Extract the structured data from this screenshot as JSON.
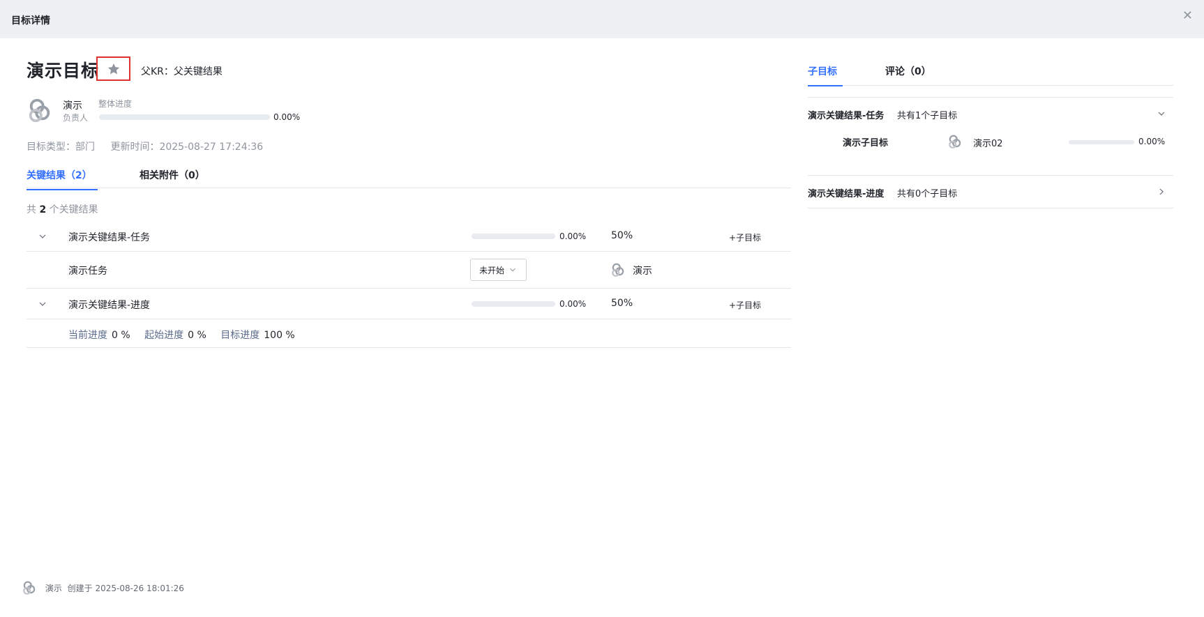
{
  "header": {
    "title": "目标详情",
    "close_icon": "close-icon"
  },
  "goal": {
    "title": "演示目标",
    "star_icon": "star-icon",
    "parent_kr": "父KR：父关键结果",
    "owner_name": "演示",
    "owner_role": "负责人",
    "overall_label": "整体进度",
    "overall_progress": 0.0,
    "overall_pct": "0.00%",
    "type_text": "目标类型：部门",
    "updated_text": "更新时间：2025-08-27 17:24:36"
  },
  "left_tabs": [
    {
      "label": "关键结果（2）",
      "active": true
    },
    {
      "label": "相关附件（0）",
      "active": false
    }
  ],
  "kr_count": {
    "prefix": "共",
    "count": "2",
    "suffix": "个关键结果"
  },
  "key_results": [
    {
      "name": "演示关键结果-任务",
      "progress": 0.0,
      "pct": "0.00%",
      "weight": "50%",
      "add_label": "+子目标"
    },
    {
      "name": "演示关键结果-进度",
      "progress": 0.0,
      "pct": "0.00%",
      "weight": "50%",
      "add_label": "+子目标"
    }
  ],
  "task": {
    "name": "演示任务",
    "status": "未开始",
    "owner": "演示"
  },
  "progress_detail": {
    "current_label": "当前进度",
    "current_value": "0 %",
    "start_label": "起始进度",
    "start_value": "0 %",
    "target_label": "目标进度",
    "target_value": "100 %"
  },
  "right_tabs": [
    {
      "label": "子目标",
      "active": true
    },
    {
      "label": "评论（0）",
      "active": false
    }
  ],
  "sub_sections": [
    {
      "title": "演示关键结果-任务",
      "count": "共有1个子目标",
      "expanded": true,
      "children": [
        {
          "name": "演示子目标",
          "owner": "演示02",
          "progress": 0.0,
          "pct": "0.00%"
        }
      ]
    },
    {
      "title": "演示关键结果-进度",
      "count": "共有0个子目标",
      "expanded": false,
      "children": []
    }
  ],
  "footer": {
    "owner": "演示",
    "created": "创建于 2025-08-26 18:01:26"
  },
  "colors": {
    "accent": "#3370ff",
    "highlight_border": "#e03131",
    "muted": "#8f959e"
  }
}
